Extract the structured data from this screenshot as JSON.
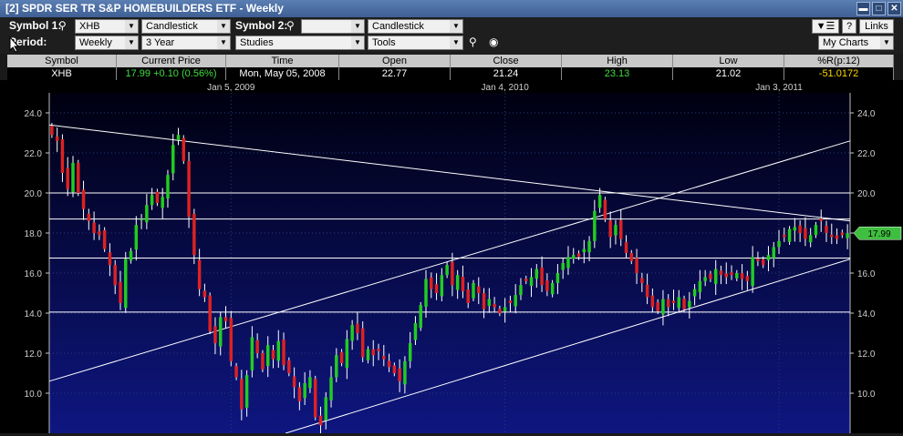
{
  "window": {
    "title": "[2] SPDR SER TR S&P HOMEBUILDERS ETF - Weekly"
  },
  "toolbar": {
    "symbol1_label": "Symbol 1:",
    "symbol1_value": "XHB",
    "chart_type1": "Candlestick",
    "symbol2_label": "Symbol 2:",
    "symbol2_value": "",
    "chart_type2": "Candlestick",
    "period_label": "Period:",
    "period": "Weekly",
    "range": "3 Year",
    "studies": "Studies",
    "tools": "Tools",
    "links": "Links",
    "help": "?",
    "my_charts": "My Charts"
  },
  "quote": {
    "headers": [
      "Symbol",
      "Current Price",
      "Time",
      "Open",
      "Close",
      "High",
      "Low",
      "%R(p:12)"
    ],
    "symbol": "XHB",
    "current_price": "17.99",
    "change": "+0.10 (0.56%)",
    "time": "Mon, May 05, 2008",
    "open": "22.77",
    "close": "21.24",
    "high": "23.13",
    "low": "21.02",
    "pct_r": "-51.0172"
  },
  "chart_data": {
    "type": "candlestick",
    "x_ticks": [
      "Jan 5, 2009",
      "Jan 4, 2010",
      "Jan 3, 2011"
    ],
    "y_ticks": [
      "24.0",
      "22.0",
      "20.0",
      "18.0",
      "16.0",
      "14.0",
      "12.0",
      "10.0"
    ],
    "ylim": [
      8.0,
      25.0
    ],
    "last_price_label": "17.99",
    "horizontal_levels": [
      20.0,
      18.7,
      16.75,
      14.05
    ],
    "trendlines": [
      {
        "from": [
          0,
          23.4
        ],
        "to": [
          1,
          18.6
        ]
      },
      {
        "from": [
          0,
          10.6
        ],
        "to": [
          1,
          22.6
        ]
      },
      {
        "from": [
          0.295,
          8.0
        ],
        "to": [
          1,
          16.7
        ]
      }
    ],
    "colors": {
      "up": "#22cc22",
      "down": "#dd2222",
      "grid": "#ffffff",
      "bg_top": "#000010",
      "bg_bottom": "#0e1680"
    },
    "closes": [
      22.9,
      22.6,
      21.0,
      20.2,
      21.5,
      20.0,
      19.2,
      18.6,
      18.0,
      17.9,
      17.2,
      16.4,
      15.4,
      14.5,
      16.7,
      17.1,
      18.4,
      18.7,
      19.4,
      19.9,
      19.5,
      19.8,
      20.9,
      22.4,
      22.9,
      21.6,
      18.8,
      16.9,
      15.2,
      14.8,
      13.1,
      12.5,
      13.8,
      13.6,
      11.6,
      10.8,
      9.2,
      10.9,
      12.8,
      12.0,
      11.2,
      12.4,
      11.7,
      12.6,
      11.4,
      11.0,
      10.3,
      9.6,
      10.5,
      10.8,
      8.8,
      8.4,
      9.8,
      10.8,
      11.9,
      11.5,
      12.7,
      13.4,
      13.0,
      11.8,
      12.2,
      11.9,
      12.1,
      11.7,
      11.3,
      11.0,
      10.6,
      11.6,
      12.5,
      13.5,
      14.4,
      15.7,
      15.2,
      15.0,
      15.9,
      16.4,
      15.4,
      15.9,
      15.1,
      14.5,
      15.5,
      15.0,
      14.2,
      14.7,
      14.3,
      14.0,
      14.3,
      14.5,
      14.9,
      15.4,
      15.6,
      15.8,
      16.2,
      15.4,
      15.1,
      15.5,
      16.0,
      16.5,
      16.8,
      16.9,
      16.8,
      17.2,
      17.6,
      19.1,
      19.9,
      18.7,
      17.8,
      18.4,
      17.7,
      17.0,
      16.6,
      16.0,
      15.5,
      14.8,
      14.3,
      14.1,
      14.7,
      14.3,
      14.5,
      14.8,
      14.2,
      14.6,
      15.2,
      15.6,
      15.8,
      15.7,
      16.2,
      15.9,
      15.8,
      15.9,
      16.0,
      15.7,
      15.6,
      16.8,
      16.6,
      16.4,
      16.9,
      17.3,
      17.6,
      17.8,
      18.2,
      18.3,
      18.0,
      17.7,
      17.9,
      18.4,
      18.6,
      18.0,
      17.8,
      17.7,
      17.9,
      17.99
    ]
  }
}
